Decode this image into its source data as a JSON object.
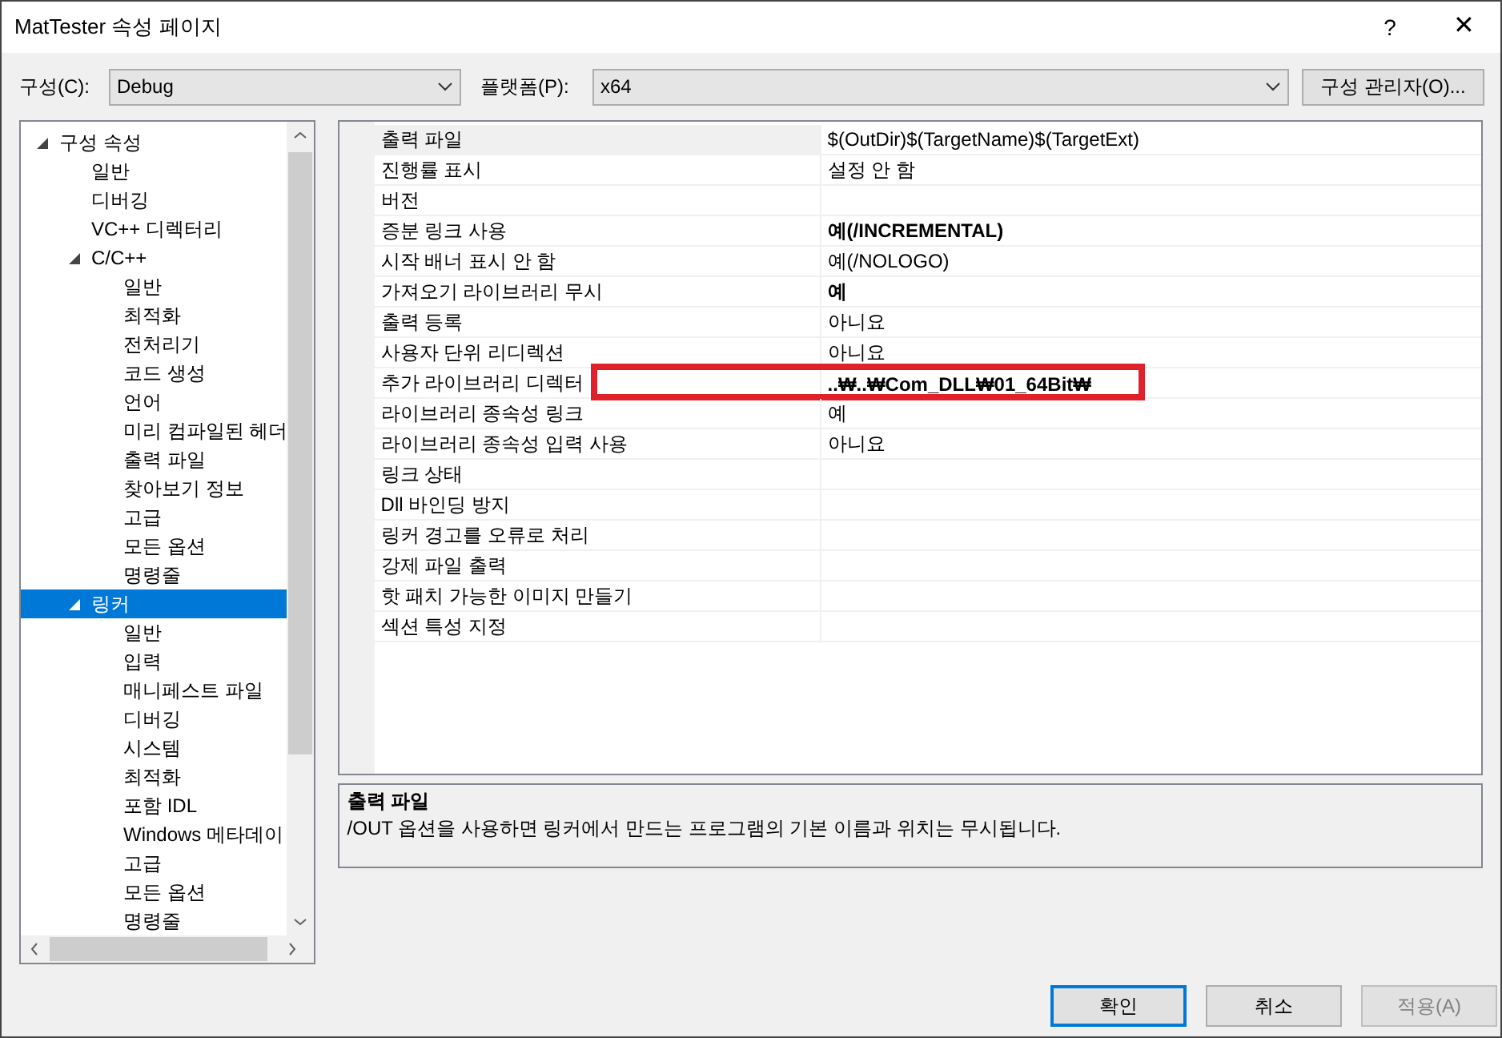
{
  "window": {
    "title": "MatTester 속성 페이지",
    "help": "?",
    "close": "✕"
  },
  "toolbar": {
    "configuration_label": "구성(C):",
    "configuration": "Debug",
    "platform_label": "플랫폼(P):",
    "platform": "x64",
    "manager_button": "구성 관리자(O)..."
  },
  "tree": [
    {
      "label": "구성 속성",
      "expanded": true,
      "selected": false,
      "children": [
        {
          "label": "일반",
          "selected": false
        },
        {
          "label": "디버깅",
          "selected": false
        },
        {
          "label": "VC++ 디렉터리",
          "selected": false
        },
        {
          "label": "C/C++",
          "expanded": true,
          "selected": false,
          "children": [
            {
              "label": "일반",
              "selected": false
            },
            {
              "label": "최적화",
              "selected": false
            },
            {
              "label": "전처리기",
              "selected": false
            },
            {
              "label": "코드 생성",
              "selected": false
            },
            {
              "label": "언어",
              "selected": false
            },
            {
              "label": "미리 컴파일된 헤더",
              "selected": false
            },
            {
              "label": "출력 파일",
              "selected": false
            },
            {
              "label": "찾아보기 정보",
              "selected": false
            },
            {
              "label": "고급",
              "selected": false
            },
            {
              "label": "모든 옵션",
              "selected": false
            },
            {
              "label": "명령줄",
              "selected": false
            }
          ]
        },
        {
          "label": "링커",
          "expanded": true,
          "selected": true,
          "children": [
            {
              "label": "일반",
              "selected": false
            },
            {
              "label": "입력",
              "selected": false
            },
            {
              "label": "매니페스트 파일",
              "selected": false
            },
            {
              "label": "디버깅",
              "selected": false
            },
            {
              "label": "시스템",
              "selected": false
            },
            {
              "label": "최적화",
              "selected": false
            },
            {
              "label": "포함 IDL",
              "selected": false
            },
            {
              "label": "Windows 메타데이",
              "selected": false
            },
            {
              "label": "고급",
              "selected": false
            },
            {
              "label": "모든 옵션",
              "selected": false
            },
            {
              "label": "명령줄",
              "selected": false
            }
          ]
        }
      ]
    }
  ],
  "properties": [
    {
      "name": "출력 파일",
      "value": "$(OutDir)$(TargetName)$(TargetExt)",
      "modified": false,
      "selected": true
    },
    {
      "name": "진행률 표시",
      "value": "설정 안 함",
      "modified": false,
      "selected": false
    },
    {
      "name": "버전",
      "selected": false
    },
    {
      "name": "증분 링크 사용",
      "value": "예(/INCREMENTAL)",
      "modified": true,
      "selected": false
    },
    {
      "name": "시작 배너 표시 안 함",
      "value": "예(/NOLOGO)",
      "modified": false,
      "selected": false
    },
    {
      "name": "가져오기 라이브러리 무시",
      "value": "예",
      "modified": true,
      "selected": false
    },
    {
      "name": "출력 등록",
      "value": "아니요",
      "modified": false,
      "selected": false
    },
    {
      "name": "사용자 단위 리디렉션",
      "value": "아니요",
      "modified": false,
      "selected": false
    },
    {
      "name": "추가 라이브러리 디렉터",
      "value": "..₩..₩Com_DLL₩01_64Bit₩",
      "modified": true,
      "selected": false,
      "highlighted": true
    },
    {
      "name": "라이브러리 종속성 링크",
      "value": "예",
      "modified": false,
      "selected": false
    },
    {
      "name": "라이브러리 종속성 입력 사용",
      "value": "아니요",
      "modified": false,
      "selected": false
    },
    {
      "name": "링크 상태",
      "selected": false
    },
    {
      "name": "Dll 바인딩 방지",
      "selected": false
    },
    {
      "name": "링커 경고를 오류로 처리",
      "selected": false
    },
    {
      "name": "강제 파일 출력",
      "selected": false
    },
    {
      "name": "핫 패치 가능한 이미지 만들기",
      "selected": false
    },
    {
      "name": "섹션 특성 지정",
      "selected": false
    }
  ],
  "description": {
    "title": "출력 파일",
    "text": "/OUT 옵션을 사용하면 링커에서 만드는 프로그램의 기본 이름과 위치는 무시됩니다."
  },
  "buttons": [
    {
      "label": "확인",
      "kind": "default",
      "disabled": false
    },
    {
      "label": "취소",
      "kind": "normal",
      "disabled": false
    },
    {
      "label": "적용(A)",
      "kind": "normal",
      "disabled": true
    }
  ]
}
